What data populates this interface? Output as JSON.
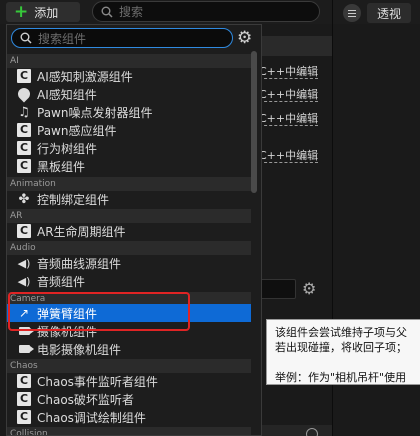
{
  "toolbar": {
    "add_label": "添加",
    "search_placeholder": "搜索",
    "perspective_label": "透视"
  },
  "background_panel": {
    "edit_rows": [
      "C++中编辑",
      "C++中编辑",
      "C++中编辑",
      "C++中编辑"
    ]
  },
  "dropdown": {
    "search_placeholder": "搜索组件",
    "categories": [
      {
        "name": "AI",
        "items": [
          {
            "label": "AI感知刺激源组件",
            "icon": "cpp-class-icon"
          },
          {
            "label": "AI感知组件",
            "icon": "location-pin-icon"
          },
          {
            "label": "Pawn噪点发射器组件",
            "icon": "noise-emitter-icon"
          },
          {
            "label": "Pawn感应组件",
            "icon": "cpp-class-icon"
          },
          {
            "label": "行为树组件",
            "icon": "cpp-class-icon"
          },
          {
            "label": "黑板组件",
            "icon": "cpp-class-icon"
          }
        ]
      },
      {
        "name": "Animation",
        "items": [
          {
            "label": "控制绑定组件",
            "icon": "control-rig-icon"
          }
        ]
      },
      {
        "name": "AR",
        "items": [
          {
            "label": "AR生命周期组件",
            "icon": "cpp-class-icon"
          }
        ]
      },
      {
        "name": "Audio",
        "items": [
          {
            "label": "音频曲线源组件",
            "icon": "speaker-icon"
          },
          {
            "label": "音频组件",
            "icon": "speaker-icon"
          }
        ]
      },
      {
        "name": "Camera",
        "items": [
          {
            "label": "弹簧臂组件",
            "icon": "spring-arm-icon",
            "selected": true
          },
          {
            "label": "摄像机组件",
            "icon": "camera-icon"
          },
          {
            "label": "电影摄像机组件",
            "icon": "camera-icon"
          }
        ]
      },
      {
        "name": "Chaos",
        "items": [
          {
            "label": "Chaos事件监听者组件",
            "icon": "cpp-class-icon"
          },
          {
            "label": "Chaos破坏监听者",
            "icon": "cpp-class-icon"
          },
          {
            "label": "Chaos调试绘制组件",
            "icon": "cpp-class-icon"
          }
        ]
      },
      {
        "name": "Collision",
        "items": []
      }
    ]
  },
  "tooltip": {
    "lines": [
      "该组件会尝试维持子项与父",
      "若出现碰撞，将收回子项；",
      "",
      "举例：作为\"相机吊杆\"使用"
    ]
  },
  "colors": {
    "accent": "#0e6ad6",
    "highlight_box": "#e02424",
    "add_plus": "#36c83a"
  }
}
